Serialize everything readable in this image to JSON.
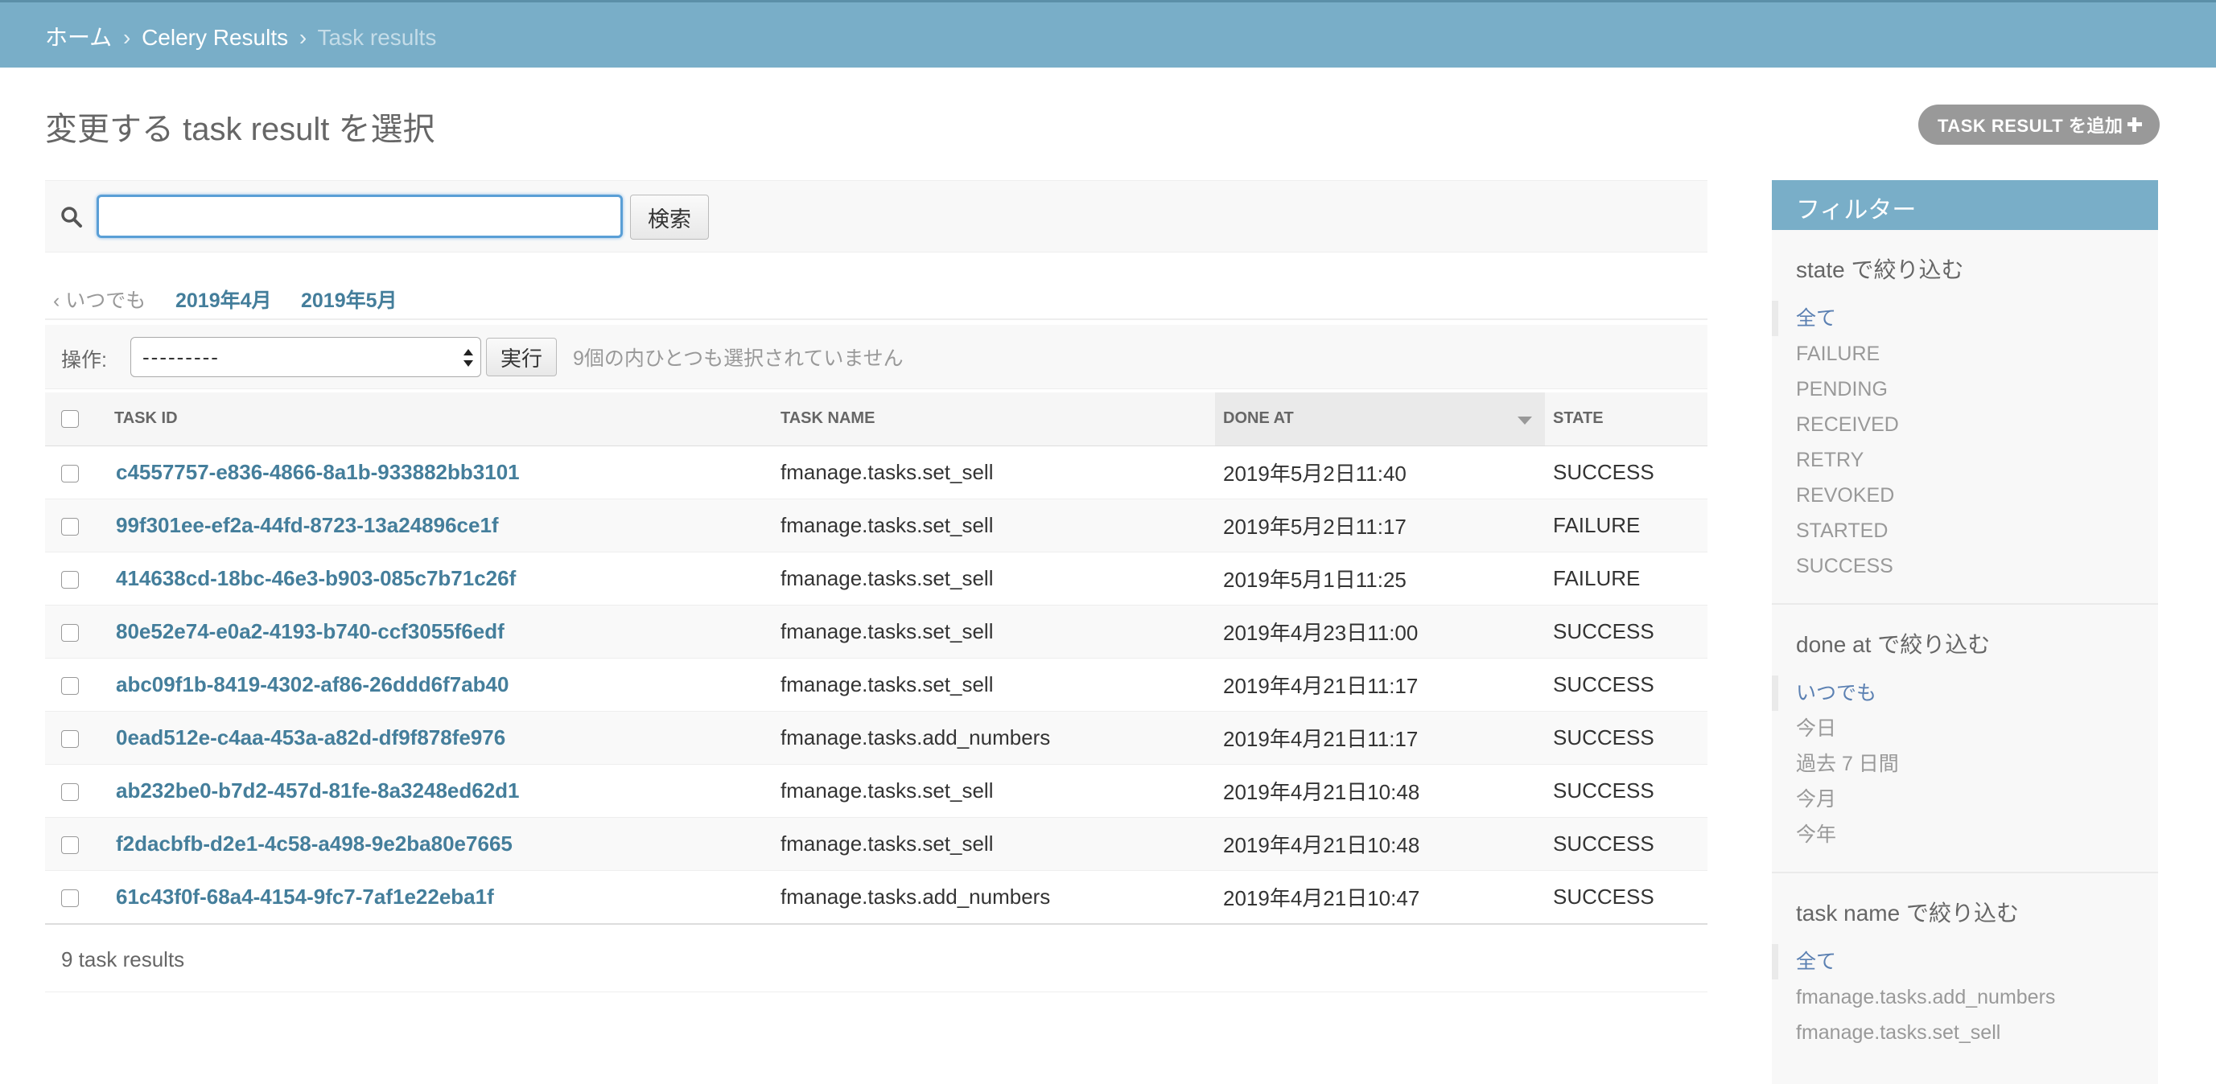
{
  "breadcrumb": {
    "home": "ホーム",
    "app": "Celery Results",
    "current": "Task results",
    "sep": "›"
  },
  "title": "変更する task result を選択",
  "add_button": "TASK RESULT を追加",
  "search": {
    "value": "",
    "button": "検索"
  },
  "date_hierarchy": {
    "back": "‹ いつでも",
    "months": [
      "2019年4月",
      "2019年5月"
    ]
  },
  "actions": {
    "label": "操作:",
    "selected": "---------",
    "run": "実行",
    "counter": "9個の内ひとつも選択されていません"
  },
  "table": {
    "headers": {
      "task_id": "Task ID",
      "task_name": "Task Name",
      "done_at": "Done At",
      "state": "State"
    },
    "rows": [
      {
        "task_id": "c4557757-e836-4866-8a1b-933882bb3101",
        "task_name": "fmanage.tasks.set_sell",
        "done_at": "2019年5月2日11:40",
        "state": "SUCCESS"
      },
      {
        "task_id": "99f301ee-ef2a-44fd-8723-13a24896ce1f",
        "task_name": "fmanage.tasks.set_sell",
        "done_at": "2019年5月2日11:17",
        "state": "FAILURE"
      },
      {
        "task_id": "414638cd-18bc-46e3-b903-085c7b71c26f",
        "task_name": "fmanage.tasks.set_sell",
        "done_at": "2019年5月1日11:25",
        "state": "FAILURE"
      },
      {
        "task_id": "80e52e74-e0a2-4193-b740-ccf3055f6edf",
        "task_name": "fmanage.tasks.set_sell",
        "done_at": "2019年4月23日11:00",
        "state": "SUCCESS"
      },
      {
        "task_id": "abc09f1b-8419-4302-af86-26ddd6f7ab40",
        "task_name": "fmanage.tasks.set_sell",
        "done_at": "2019年4月21日11:17",
        "state": "SUCCESS"
      },
      {
        "task_id": "0ead512e-c4aa-453a-a82d-df9f878fe976",
        "task_name": "fmanage.tasks.add_numbers",
        "done_at": "2019年4月21日11:17",
        "state": "SUCCESS"
      },
      {
        "task_id": "ab232be0-b7d2-457d-81fe-8a3248ed62d1",
        "task_name": "fmanage.tasks.set_sell",
        "done_at": "2019年4月21日10:48",
        "state": "SUCCESS"
      },
      {
        "task_id": "f2dacbfb-d2e1-4c58-a498-9e2ba80e7665",
        "task_name": "fmanage.tasks.set_sell",
        "done_at": "2019年4月21日10:48",
        "state": "SUCCESS"
      },
      {
        "task_id": "61c43f0f-68a4-4154-9fc7-7af1e22eba1f",
        "task_name": "fmanage.tasks.add_numbers",
        "done_at": "2019年4月21日10:47",
        "state": "SUCCESS"
      }
    ]
  },
  "paginator": "9 task results",
  "filter": {
    "title": "フィルター",
    "state": {
      "heading": "state で絞り込む",
      "options": [
        "全て",
        "FAILURE",
        "PENDING",
        "RECEIVED",
        "RETRY",
        "REVOKED",
        "STARTED",
        "SUCCESS"
      ]
    },
    "done_at": {
      "heading": "done at で絞り込む",
      "options": [
        "いつでも",
        "今日",
        "過去 7 日間",
        "今月",
        "今年"
      ]
    },
    "task_name": {
      "heading": "task name で絞り込む",
      "options": [
        "全て",
        "fmanage.tasks.add_numbers",
        "fmanage.tasks.set_sell"
      ]
    }
  },
  "colors": {
    "header_bar": "#79aec8",
    "link": "#447e9b",
    "filter_selected": "#5b80b2"
  }
}
